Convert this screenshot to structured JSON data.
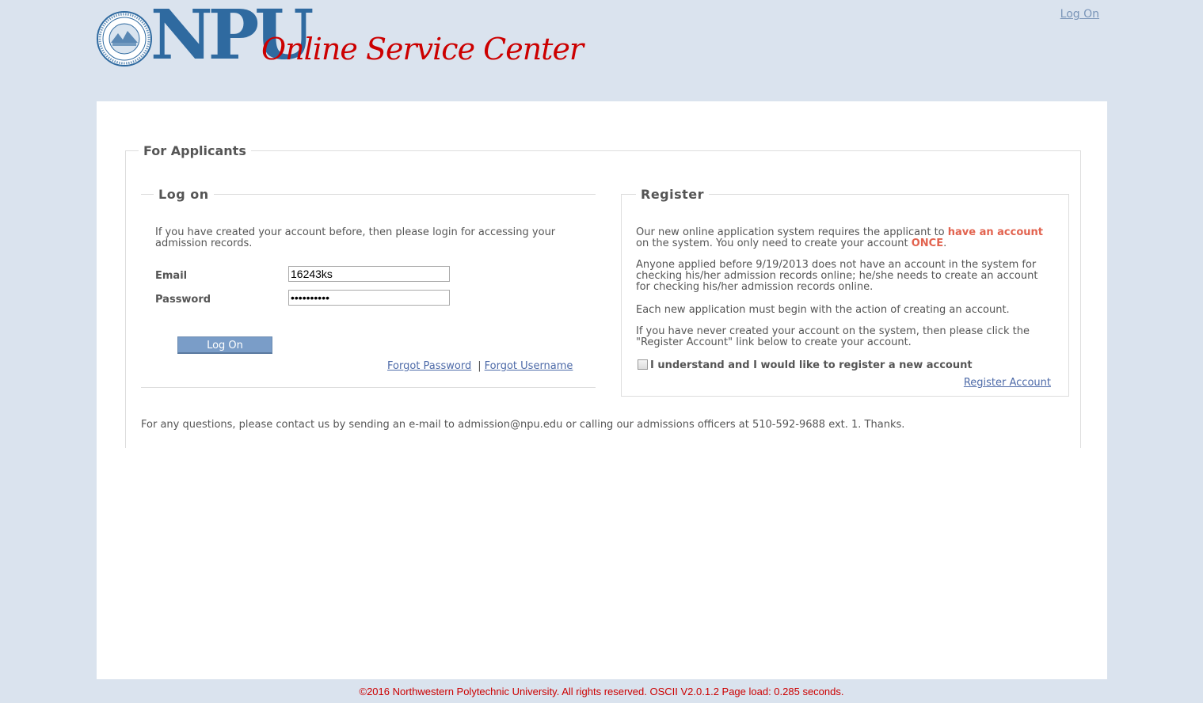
{
  "header": {
    "logo_text": "NPU",
    "tagline": "Online Service Center",
    "logon_link": "Log On"
  },
  "applicants": {
    "legend": "For Applicants",
    "logon": {
      "legend": "Log on",
      "intro": "If you have created your account before, then please login for accessing your admission records.",
      "email_label": "Email",
      "email_value": "16243ks",
      "password_label": "Password",
      "password_value": "••••••••••",
      "button_label": "Log On",
      "forgot_password": "Forgot Password",
      "separator": "|",
      "forgot_username": "Forgot Username"
    },
    "register": {
      "legend": "Register",
      "p1_a": "Our new online application system requires the applicant to ",
      "p1_highlight": "have an account",
      "p1_b": " on the system. You only need to create your account ",
      "p1_once": "ONCE",
      "p1_c": ".",
      "p2": "Anyone applied before 9/19/2013 does not have an account in the system for checking his/her admission records online; he/she needs to create an account for checking his/her admission records online.",
      "p3": "Each new application must begin with the action of creating an account.",
      "p4": "If you have never created your account on the system, then please click the \"Register Account\" link below to create your account.",
      "agree_label": "I understand and I would like to register a new account",
      "agree_checked": false,
      "register_link": "Register Account"
    },
    "contact": "For any questions, please contact us by sending an e-mail to admission@npu.edu or calling our admissions officers at 510-592-9688 ext. 1. Thanks."
  },
  "footer": {
    "text": "©2016 Northwestern Polytechnic University. All rights reserved. OSCII V2.0.1.2 Page load: 0.285 seconds."
  },
  "colors": {
    "background": "#dae3ee",
    "logo_blue": "#2f6aa0",
    "tagline_red": "#cc0000",
    "highlight": "#e2634f",
    "link": "#4d6aa8",
    "button": "#7a9dc8"
  }
}
